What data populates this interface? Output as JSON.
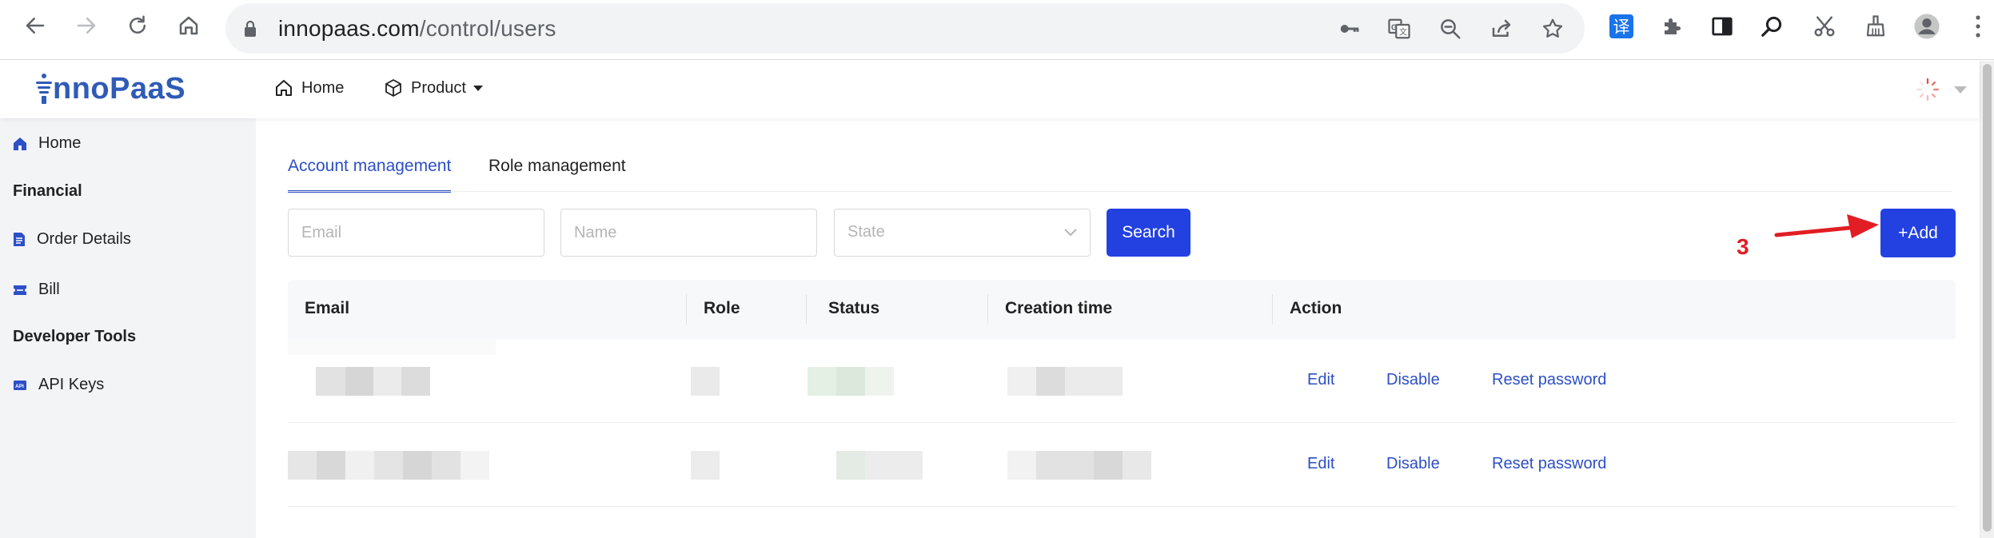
{
  "browser": {
    "url_host": "innopaas.com",
    "url_path": "/control/users",
    "extension_badge": "译"
  },
  "header": {
    "logo_text": "nnoPaaS",
    "nav": [
      {
        "label": "Home",
        "icon": "home-icon"
      },
      {
        "label": "Product",
        "icon": "cube-icon"
      }
    ]
  },
  "sidebar": {
    "home": "Home",
    "section_financial": "Financial",
    "order_details": "Order Details",
    "bill": "Bill",
    "section_developer": "Developer Tools",
    "api_keys": "API Keys"
  },
  "tabs": [
    {
      "label": "Account management",
      "active": true
    },
    {
      "label": "Role management",
      "active": false
    }
  ],
  "filters": {
    "email_placeholder": "Email",
    "name_placeholder": "Name",
    "state_placeholder": "State",
    "search_label": "Search"
  },
  "add_button": "+Add",
  "annotation": {
    "step_number": "3",
    "color": "#e21d24"
  },
  "table": {
    "columns": [
      "Email",
      "Role",
      "Status",
      "Creation time",
      "Action"
    ],
    "rows": [
      {
        "actions": [
          "Edit",
          "Disable",
          "Reset password"
        ]
      },
      {
        "actions": [
          "Edit",
          "Disable",
          "Reset password"
        ]
      }
    ]
  },
  "colors": {
    "primary": "#2341e0",
    "link": "#2d4fc7",
    "logo": "#2f5bb7"
  }
}
